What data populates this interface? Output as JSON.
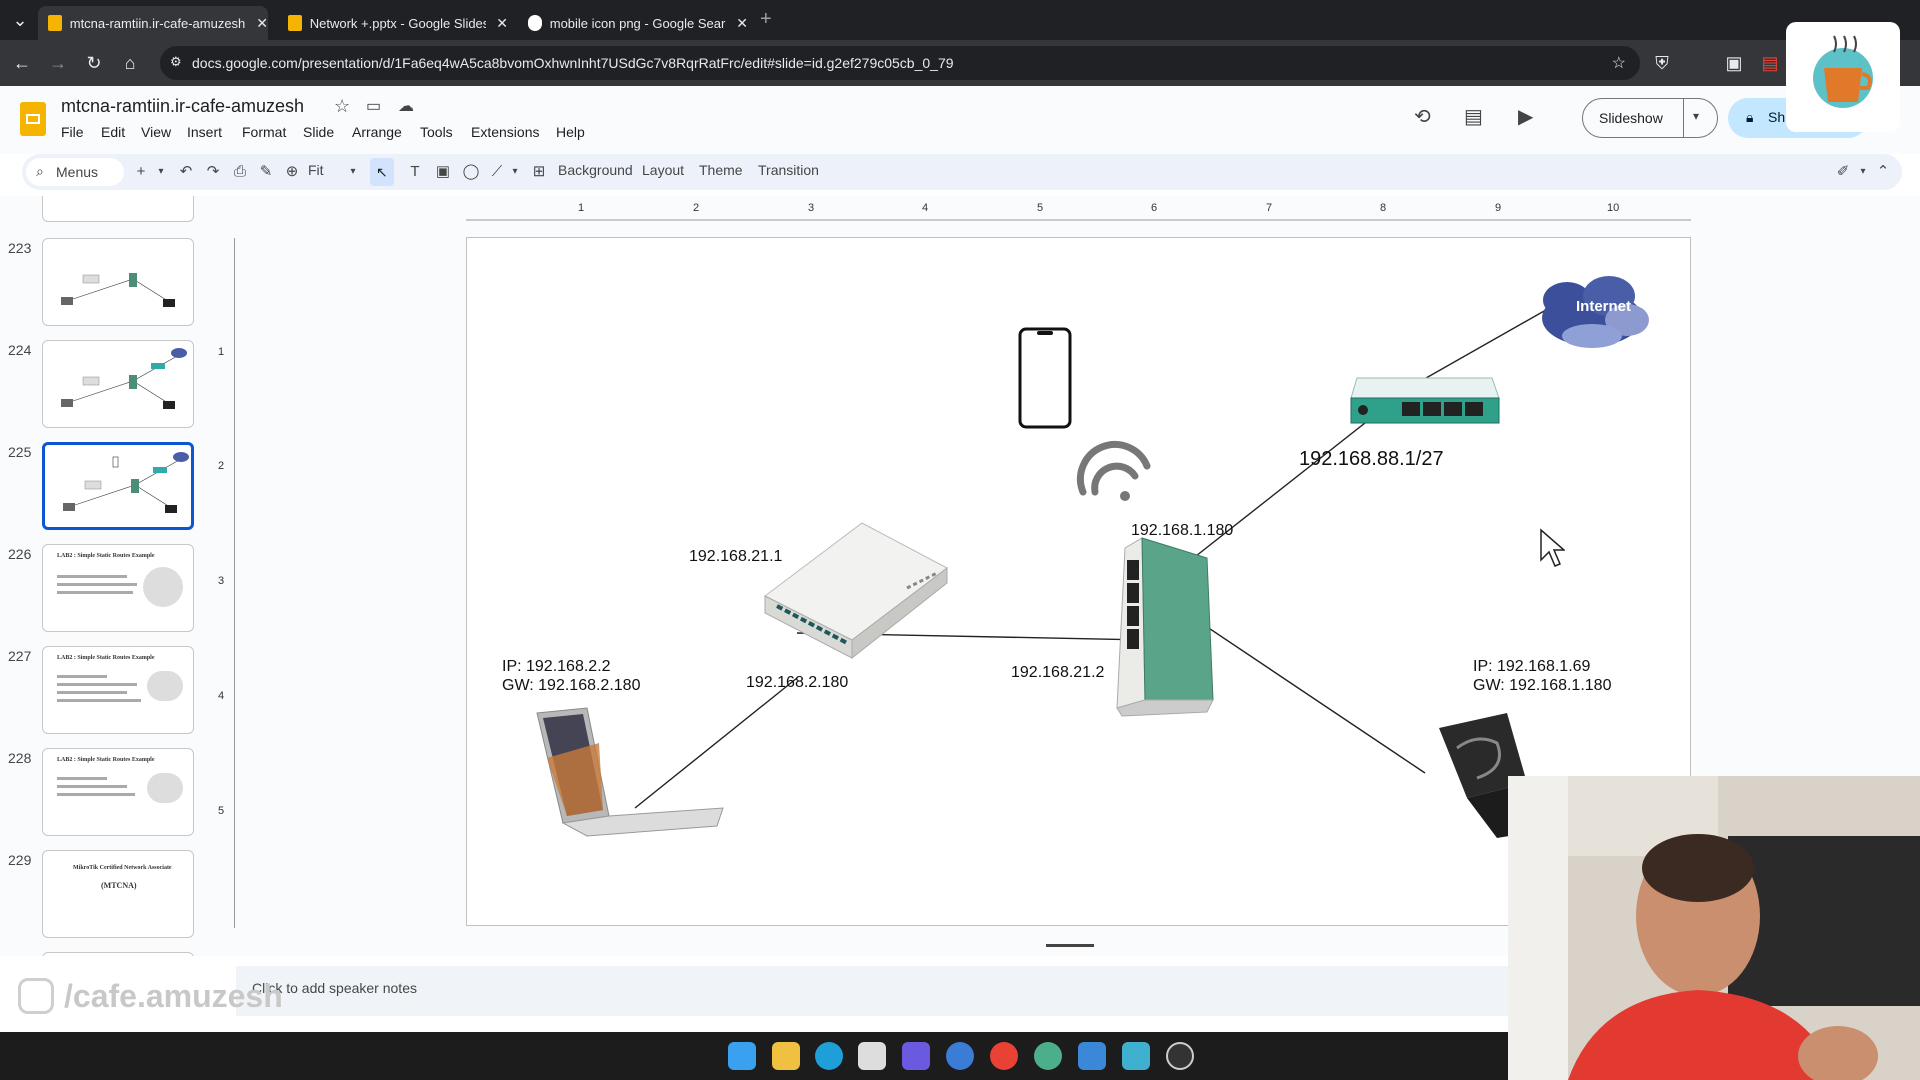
{
  "browser": {
    "tabs": [
      {
        "title": "mtcna-ramtiin.ir-cafe-amuzesh",
        "active": true
      },
      {
        "title": "Network +.pptx - Google Slides",
        "active": false
      },
      {
        "title": "mobile icon png - Google Search",
        "active": false
      }
    ],
    "new_tab": "+",
    "url": "docs.google.com/presentation/d/1Fa6eq4wA5ca8bvomOxhwnInht7USdGc7v8RqrRatFrc/edit#slide=id.g2ef279c05cb_0_79"
  },
  "app": {
    "doc_title": "mtcna-ramtiin.ir-cafe-amuzesh",
    "menus": [
      "File",
      "Edit",
      "View",
      "Insert",
      "Format",
      "Slide",
      "Arrange",
      "Tools",
      "Extensions",
      "Help"
    ],
    "slideshow_label": "Slideshow",
    "share_label": "Sh"
  },
  "toolbar": {
    "search_label": "Menus",
    "zoom_value": "Fit",
    "background_label": "Background",
    "layout_label": "Layout",
    "theme_label": "Theme",
    "transition_label": "Transition"
  },
  "ruler": {
    "marks": [
      "1",
      "2",
      "3",
      "4",
      "5",
      "6",
      "7",
      "8",
      "9",
      "10"
    ],
    "vmarks": [
      "1",
      "2",
      "3",
      "4",
      "5"
    ]
  },
  "filmstrip": {
    "slides": [
      {
        "number": "223",
        "title": ""
      },
      {
        "number": "224",
        "title": ""
      },
      {
        "number": "225",
        "title": "",
        "selected": true
      },
      {
        "number": "226",
        "title": "LAB2 : Simple Static Routes Example"
      },
      {
        "number": "227",
        "title": "LAB2 : Simple Static Routes Example"
      },
      {
        "number": "228",
        "title": "LAB2 : Simple Static Routes Example"
      },
      {
        "number": "229",
        "title": "MikroTik Certified Network Associate",
        "subtitle": "(MTCNA)"
      }
    ]
  },
  "slide": {
    "cloud_label": "Internet",
    "wan_ip": "192.168.88.1/27",
    "router_lan_ip": "192.168.1.180",
    "switch_ip_top": "192.168.21.1",
    "switch_ip_bottom": "192.168.2.180",
    "router_link_ip": "192.168.21.2",
    "laptop_left_ip": "IP: 192.168.2.2",
    "laptop_left_gw": "GW: 192.168.2.180",
    "laptop_right_ip": "IP: 192.168.1.69",
    "laptop_right_gw": "GW: 192.168.1.180"
  },
  "notes": {
    "placeholder": "Click to add speaker notes"
  },
  "watermark": {
    "handle": "/cafe.amuzesh",
    "logo_text": "CAFE AMUZESH"
  },
  "colors": {
    "accent": "#0b57d0",
    "router_green": "#5aa58a",
    "cloud": "#4a5ea8"
  }
}
